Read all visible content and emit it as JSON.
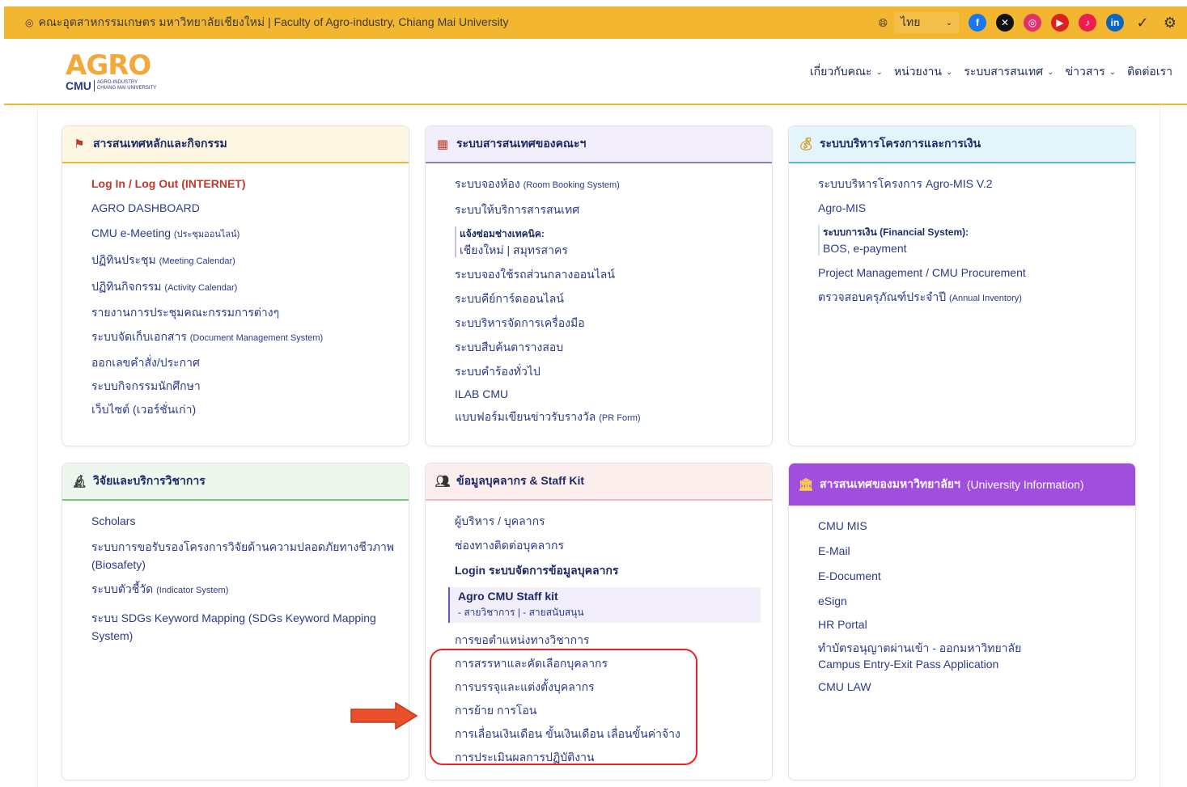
{
  "topbar": {
    "location": "คณะอุตสาหกรรมเกษตร มหาวิทยาลัยเชียงใหม่ | Faculty of Agro-industry, Chiang Mai University",
    "language": "ไทย"
  },
  "logo": {
    "agro": "AGRO",
    "cmu": "CMU",
    "sub1": "AGRO-INDUSTRY",
    "sub2": "CHIANG MAI UNIVERSITY"
  },
  "nav": [
    {
      "label": "เกี่ยวกับคณะ"
    },
    {
      "label": "หน่วยงาน"
    },
    {
      "label": "ระบบสารสนเทศ"
    },
    {
      "label": "ข่าวสาร"
    },
    {
      "label": "ติดต่อเรา"
    }
  ],
  "cards": {
    "main_info": {
      "title": "สารสนเทศหลักและกิจกรรม",
      "links": [
        {
          "text": "Log In / Log Out (INTERNET)"
        },
        {
          "text": "AGRO DASHBOARD"
        },
        {
          "text": "CMU e-Meeting",
          "small": "(ประชุมออนไลน์)"
        },
        {
          "text": "ปฏิทินประชุม",
          "small": "(Meeting Calendar)"
        },
        {
          "text": "ปฏิทินกิจกรรม",
          "small": "(Activity Calendar)"
        },
        {
          "text": "รายงานการประชุมคณะกรรมการต่างๆ"
        },
        {
          "text": "ระบบจัดเก็บเอกสาร",
          "small": "(Document  Management System)"
        },
        {
          "text": "ออกเลขคำสั่ง/ประกาศ"
        },
        {
          "text": "ระบบกิจกรรมนักศึกษา"
        },
        {
          "text": "เว็บไซต์ (เวอร์ชั่นเก่า)"
        }
      ]
    },
    "faculty_systems": {
      "title": "ระบบสารสนเทศของคณะฯ",
      "links": [
        {
          "text": "ระบบจองห้อง",
          "small": "(Room Booking System)"
        },
        {
          "text": "ระบบให้บริการสารสนเทศ"
        },
        {
          "text": "แจ้งซ่อมช่างเทคนิค:",
          "sub": "เชียงใหม่ | สมุทรสาคร"
        },
        {
          "text": "ระบบจองใช้รถส่วนกลางออนไลน์"
        },
        {
          "text": "ระบบคีย์การ์ดออนไลน์"
        },
        {
          "text": "ระบบริหารจัดการเครื่องมือ"
        },
        {
          "text": "ระบบสืบค้นตารางสอบ"
        },
        {
          "text": "ระบบคำร้องทั่วไป"
        },
        {
          "text": "ILAB CMU"
        },
        {
          "text": "แบบฟอร์มเขียนข่าวรับรางวัล",
          "small": "(PR Form)"
        }
      ]
    },
    "finance": {
      "title": "ระบบบริหารโครงการและการเงิน",
      "links": [
        {
          "text": "ระบบบริหารโครงการ Agro-MIS V.2"
        },
        {
          "text": "Agro-MIS"
        },
        {
          "text": "ระบบการเงิน (Financial System):",
          "sub": "BOS, e-payment"
        },
        {
          "text": "Project Management / CMU Procurement"
        },
        {
          "text": "ตรวจสอบครุภัณฑ์ประจำปี",
          "small": "(Annual Inventory)"
        }
      ]
    },
    "research": {
      "title": "วิจัยและบริการวิชาการ",
      "links": [
        {
          "text": "Scholars"
        },
        {
          "text": "ระบบการขอรับรองโครงการวิจัยด้านความปลอดภัยทางชีวภาพ (Biosafety)"
        },
        {
          "text": "ระบบตัวชี้วัด",
          "small": "(Indicator System)"
        },
        {
          "text": "ระบบ SDGs Keyword Mapping (SDGs Keyword Mapping System)"
        }
      ]
    },
    "staff": {
      "title": "ข้อมูลบุคลากร & Staff Kit",
      "links": [
        {
          "text": "ผู้บริหาร / บุคลากร"
        },
        {
          "text": "ช่องทางติดต่อบุคลากร"
        },
        {
          "text": "Login ระบบจัดการข้อมูลบุคลากร"
        },
        {
          "text": "Agro CMU Staff kit",
          "sub": "- สายวิชาการ | - สายสนับสนุน"
        },
        {
          "text": "การขอตำแหน่งทางวิชาการ"
        },
        {
          "text": "การสรรหาและคัดเลือกบุคลากร"
        },
        {
          "text": "การบรรจุและแต่งตั้งบุคลากร"
        },
        {
          "text": "การย้าย การโอน"
        },
        {
          "text": "การเลื่อนเงินเดือน ขั้นเงินเดือน เลื่อนขั้นค่าจ้าง"
        },
        {
          "text": "การประเมินผลการปฏิบัติงาน"
        }
      ]
    },
    "university": {
      "title": "สารสนเทศของมหาวิทยาลัยฯ",
      "title_en": "(University Information)",
      "links": [
        {
          "text": "CMU MIS"
        },
        {
          "text": "E-Mail"
        },
        {
          "text": "E-Document"
        },
        {
          "text": "eSign"
        },
        {
          "text": "HR Portal"
        },
        {
          "text": "ทำบัตรอนุญาตผ่านเข้า - ออกมหาวิทยาลัย",
          "sub": "Campus Entry-Exit Pass Application"
        },
        {
          "text": "CMU LAW"
        }
      ]
    }
  },
  "colors": {
    "topbar": "#f2b631",
    "university_header": "#a14dde",
    "highlight": "#e22222",
    "arrow": "#e8502a"
  }
}
